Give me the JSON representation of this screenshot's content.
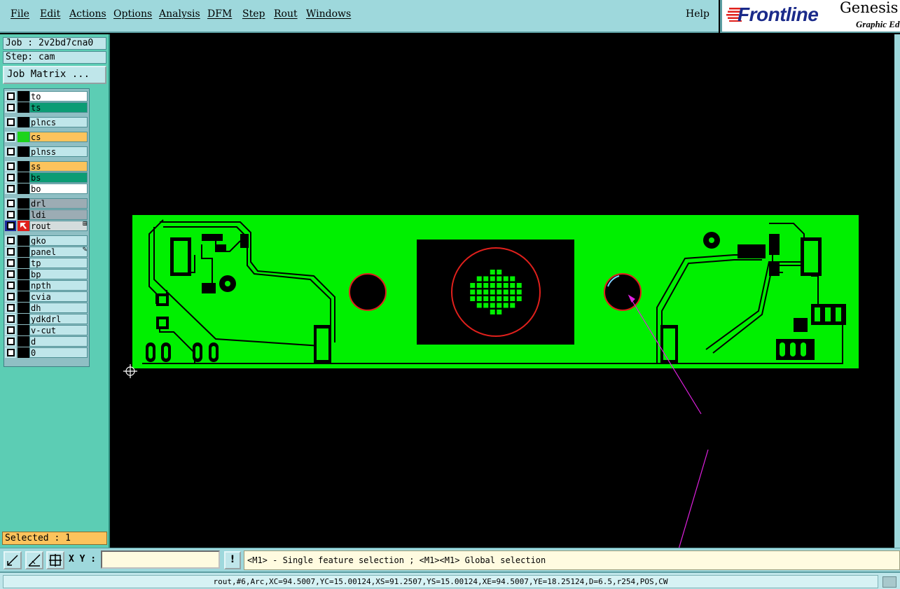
{
  "menu": {
    "items": [
      {
        "label": "File"
      },
      {
        "label": "Edit"
      },
      {
        "label": "Actions"
      },
      {
        "label": "Options"
      },
      {
        "label": "Analysis"
      },
      {
        "label": "DFM"
      },
      {
        "label": "Step"
      },
      {
        "label": "Rout"
      },
      {
        "label": "Windows"
      }
    ],
    "help": "Help"
  },
  "logo": {
    "brand": "Frontline",
    "product": "Genesis",
    "subtitle": "Graphic Ed",
    "brand_color": "#1a2a8a",
    "accent_color": "#e0201c"
  },
  "job": {
    "job_label": "Job : 2v2bd7cna0",
    "step_label": "Step: cam",
    "matrix_button": "Job Matrix ..."
  },
  "layers": [
    {
      "name": "to",
      "color": "#ffffff",
      "swatch": "#000000"
    },
    {
      "name": "ts",
      "color": "#0c9c74",
      "swatch": "#000000"
    },
    {
      "name": "plncs",
      "color": "#bfe6ea",
      "swatch": "#000000"
    },
    {
      "name": "cs",
      "color": "#fcc35c",
      "swatch": "#1cd41c"
    },
    {
      "name": "plnss",
      "color": "#bfe6ea",
      "swatch": "#000000"
    },
    {
      "name": "ss",
      "color": "#fcc35c",
      "swatch": "#000000"
    },
    {
      "name": "bs",
      "color": "#0c9c74",
      "swatch": "#000000"
    },
    {
      "name": "bo",
      "color": "#ffffff",
      "swatch": "#000000"
    },
    {
      "name": "drl",
      "color": "#9cacb4",
      "swatch": "#000000"
    },
    {
      "name": "ldi",
      "color": "#9cacb4",
      "swatch": "#000000"
    },
    {
      "name": "rout",
      "color": "#d4dcdc",
      "swatch": "#e0201c",
      "active": true,
      "mark": "⊞"
    },
    {
      "name": "gko",
      "color": "#bfe6ea",
      "swatch": "#000000"
    },
    {
      "name": "panel",
      "color": "#bfe6ea",
      "swatch": "#000000",
      "mark": "✎"
    },
    {
      "name": "tp",
      "color": "#bfe6ea",
      "swatch": "#000000"
    },
    {
      "name": "bp",
      "color": "#bfe6ea",
      "swatch": "#000000"
    },
    {
      "name": "npth",
      "color": "#bfe6ea",
      "swatch": "#000000"
    },
    {
      "name": "cvia",
      "color": "#bfe6ea",
      "swatch": "#000000"
    },
    {
      "name": "dh",
      "color": "#bfe6ea",
      "swatch": "#000000"
    },
    {
      "name": "ydkdrl",
      "color": "#bfe6ea",
      "swatch": "#000000"
    },
    {
      "name": "v-cut",
      "color": "#bfe6ea",
      "swatch": "#000000"
    },
    {
      "name": "d",
      "color": "#bfe6ea",
      "swatch": "#000000"
    },
    {
      "name": "0",
      "color": "#bfe6ea",
      "swatch": "#000000"
    }
  ],
  "selected": "Selected : 1",
  "command": {
    "xy_label": "X Y :",
    "xy_value": "",
    "excl": "!",
    "hint": "<M1> - Single feature selection ; <M1><M1> Global selection"
  },
  "status": "rout,#6,Arc,XC=94.5007,YC=15.00124,XS=91.2507,YS=15.00124,XE=94.5007,YE=18.25124,D=6.5,r254,POS,CW",
  "colors": {
    "board": "#00f000",
    "canvas": "#000000",
    "rout_circle": "#e0201c",
    "annotation": "#e020e0"
  }
}
